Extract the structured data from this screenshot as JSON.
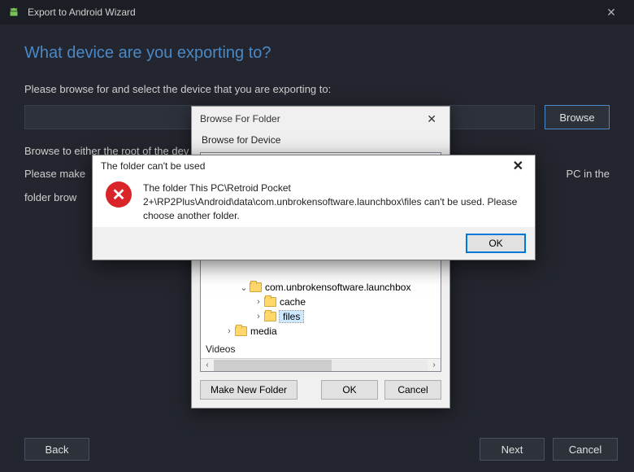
{
  "wizard": {
    "title": "Export to Android Wizard",
    "heading": "What device are you exporting to?",
    "instr1": "Please browse for and select the device that you are exporting to:",
    "instr2": "Browse to either the root of the dev",
    "instr3a": "Please make",
    "instr3b": "PC in the",
    "instr4": "folder brow",
    "browse_label": "Browse",
    "back_label": "Back",
    "next_label": "Next",
    "cancel_label": "Cancel"
  },
  "bff": {
    "title": "Browse For Folder",
    "subtitle": "Browse for Device",
    "make_label": "Make New Folder",
    "ok_label": "OK",
    "cancel_label": "Cancel",
    "tree": {
      "node1": "com.unbrokensoftware.launchbox",
      "node2": "cache",
      "node3": "files",
      "node4": "media",
      "videos": "Videos"
    }
  },
  "msg": {
    "title": "The folder can't be used",
    "text": "The folder This PC\\Retroid Pocket 2+\\RP2Plus\\Android\\data\\com.unbrokensoftware.launchbox\\files can't be used. Please choose another folder.",
    "ok_label": "OK"
  }
}
